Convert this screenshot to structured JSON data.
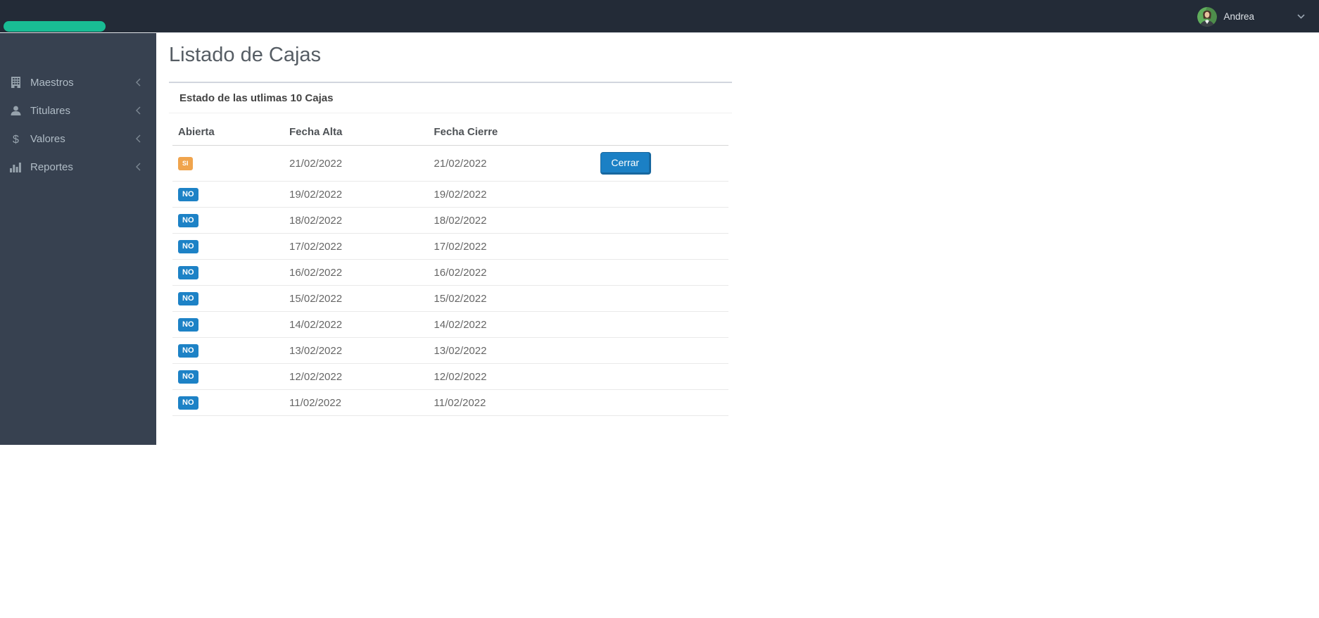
{
  "navbar": {
    "brand_pill_color": "#19bc94",
    "user": {
      "name": "Andrea"
    }
  },
  "sidebar": {
    "items": [
      {
        "label": "Maestros",
        "icon": "building-icon"
      },
      {
        "label": "Titulares",
        "icon": "user-icon"
      },
      {
        "label": "Valores",
        "icon": "dollar-icon"
      },
      {
        "label": "Reportes",
        "icon": "bar-chart-icon"
      }
    ]
  },
  "main": {
    "page_title": "Listado de Cajas",
    "box": {
      "header": "Estado de las utlimas 10 Cajas",
      "table": {
        "columns": [
          "Abierta",
          "Fecha Alta",
          "Fecha Cierre",
          ""
        ],
        "rows": [
          {
            "abierta": "SI",
            "fecha_alta": "21/02/2022",
            "fecha_cierre": "21/02/2022",
            "action": "Cerrar"
          },
          {
            "abierta": "NO",
            "fecha_alta": "19/02/2022",
            "fecha_cierre": "19/02/2022"
          },
          {
            "abierta": "NO",
            "fecha_alta": "18/02/2022",
            "fecha_cierre": "18/02/2022"
          },
          {
            "abierta": "NO",
            "fecha_alta": "17/02/2022",
            "fecha_cierre": "17/02/2022"
          },
          {
            "abierta": "NO",
            "fecha_alta": "16/02/2022",
            "fecha_cierre": "16/02/2022"
          },
          {
            "abierta": "NO",
            "fecha_alta": "15/02/2022",
            "fecha_cierre": "15/02/2022"
          },
          {
            "abierta": "NO",
            "fecha_alta": "14/02/2022",
            "fecha_cierre": "14/02/2022"
          },
          {
            "abierta": "NO",
            "fecha_alta": "13/02/2022",
            "fecha_cierre": "13/02/2022"
          },
          {
            "abierta": "NO",
            "fecha_alta": "12/02/2022",
            "fecha_cierre": "12/02/2022"
          },
          {
            "abierta": "NO",
            "fecha_alta": "11/02/2022",
            "fecha_cierre": "11/02/2022"
          }
        ]
      }
    }
  },
  "colors": {
    "navbar_bg": "#232b37",
    "sidebar_bg": "#374150",
    "badge_open": "#f0a44d",
    "badge_closed": "#1d82c6",
    "button_primary": "#1b80c5",
    "brand_green": "#19bc94"
  }
}
